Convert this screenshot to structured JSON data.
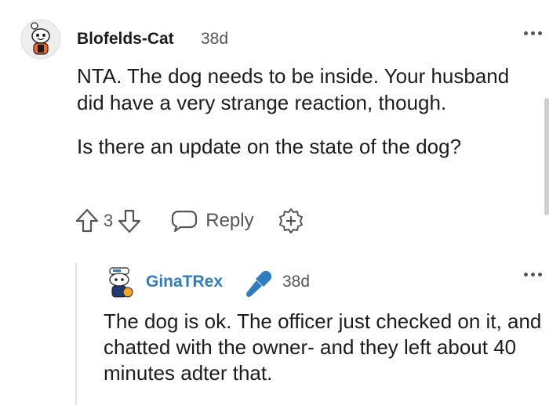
{
  "comment": {
    "author": "Blofelds-Cat",
    "time": "38d",
    "paragraphs": [
      "NTA. The dog needs to be inside. Your husband did have a very strange reaction, though.",
      "Is there an update on the state of the dog?"
    ],
    "score": "3",
    "reply_label": "Reply",
    "icons": [
      "avatar",
      "upvote-icon",
      "downvote-icon",
      "reply-bubble-icon",
      "award-plus-icon",
      "more-icon"
    ]
  },
  "reply": {
    "author": "GinaTRex",
    "time": "38d",
    "text": "The dog is ok. The officer just checked on it, and chatted with the owner- and they left about 40 minutes adter that.",
    "icons": [
      "avatar",
      "microphone-icon",
      "more-icon"
    ]
  },
  "colors": {
    "text": "#1c1c1c",
    "muted": "#555555",
    "username_blue": "#2f7cc0",
    "thread_line": "#e2e2e2"
  }
}
